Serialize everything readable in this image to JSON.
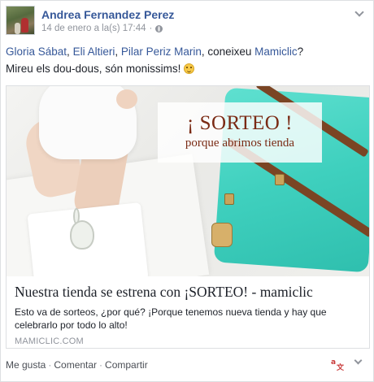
{
  "post": {
    "author": "Andrea Fernandez Perez",
    "timestamp": "14 de enero a la(s) 17:44",
    "meta_separator": "·",
    "privacy_icon": "globe-icon",
    "menu_icon": "chevron-down-icon"
  },
  "message": {
    "tag_1": "Gloria Sábat",
    "sep_1": ", ",
    "tag_2": "Eli Altieri",
    "sep_2": ", ",
    "tag_3": "Pilar Periz Marin",
    "mid_text": ", coneixeu ",
    "tag_4": "Mamiclic",
    "end_text": "?",
    "line_2": "Mireu els dou-dous, són monissims! ",
    "emoji": "smile-emoji"
  },
  "link_preview": {
    "image_title": "¡ SORTEO !",
    "image_subtitle": "porque abrimos tienda",
    "title": "Nuestra tienda se estrena con ¡SORTEO! - mamiclic",
    "description": "Esto va de sorteos, ¿por qué? ¡Porque tenemos nueva tienda y hay que celebrarlo por todo lo alto!",
    "domain": "MAMICLIC.COM"
  },
  "actions": {
    "like": "Me gusta",
    "comment": "Comentar",
    "share": "Compartir",
    "separator": "·",
    "translate_icon": "translate-icon",
    "translate_glyph": "a",
    "translate_glyph_2": "文"
  },
  "colors": {
    "link": "#365899",
    "meta": "#90949c",
    "text": "#1d2129"
  }
}
